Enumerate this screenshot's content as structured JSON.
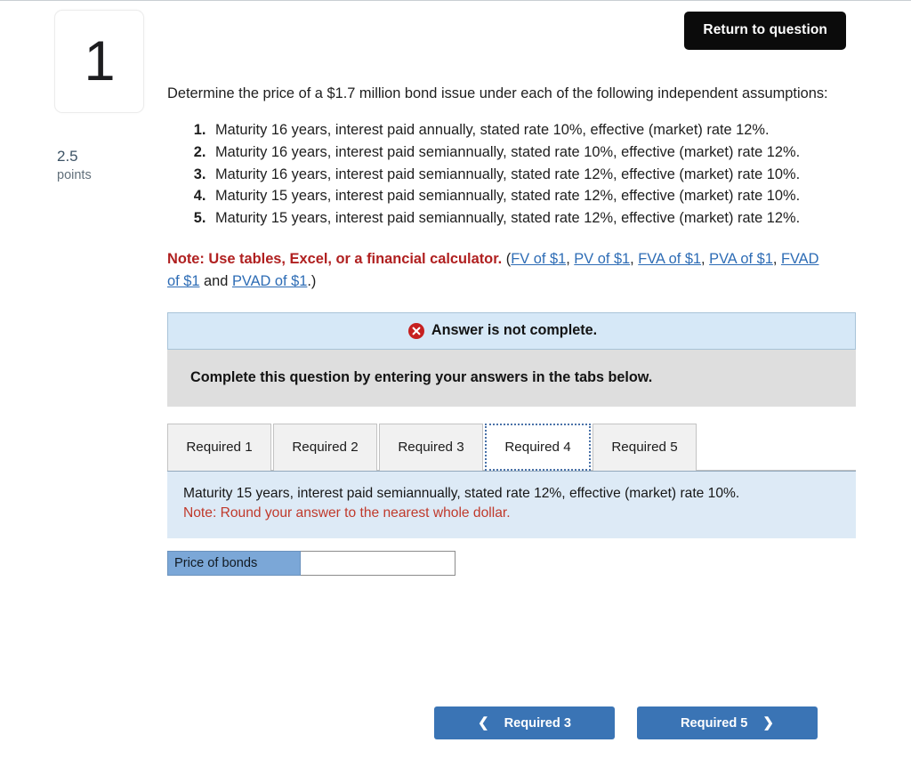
{
  "header": {
    "return_button_label": "Return to question"
  },
  "question_meta": {
    "number": "1",
    "points_value": "2.5",
    "points_label": "points"
  },
  "question": {
    "intro": "Determine the price of a $1.7 million bond issue under each of the following independent assumptions:",
    "assumptions": [
      "Maturity 16 years, interest paid annually, stated rate 10%, effective (market) rate 12%.",
      "Maturity 16 years, interest paid semiannually, stated rate 10%, effective (market) rate 12%.",
      "Maturity 16 years, interest paid semiannually, stated rate 12%, effective (market) rate 10%.",
      "Maturity 15 years, interest paid semiannually, stated rate 12%, effective (market) rate 10%.",
      "Maturity 15 years, interest paid semiannually, stated rate 12%, effective (market) rate 12%."
    ],
    "note_bold": "Note: Use tables, Excel, or a financial calculator.",
    "note_open_paren": " (",
    "note_links": [
      "FV of $1",
      "PV of $1",
      "FVA of $1",
      "PVA of $1",
      "FVAD of $1",
      "PVAD of $1"
    ],
    "note_separator": ", ",
    "note_and": " and ",
    "note_close_paren": ".)"
  },
  "status": {
    "icon": "error-circle-x-icon",
    "text": "Answer is not complete.",
    "instruction": "Complete this question by entering your answers in the tabs below."
  },
  "tabs": {
    "items": [
      {
        "label": "Required 1",
        "active": false
      },
      {
        "label": "Required 2",
        "active": false
      },
      {
        "label": "Required 3",
        "active": false
      },
      {
        "label": "Required 4",
        "active": true
      },
      {
        "label": "Required 5",
        "active": false
      }
    ],
    "active_index": 3
  },
  "panel": {
    "prompt": "Maturity 15 years, interest paid semiannually, stated rate 12%, effective (market) rate 10%.",
    "note": "Note: Round your answer to the nearest whole dollar."
  },
  "answer": {
    "label": "Price of bonds",
    "value": "",
    "placeholder": ""
  },
  "bottom_nav": {
    "prev_label": "Required 3",
    "prev_icon": "chevron-left-icon",
    "next_label": "Required 5",
    "next_icon": "chevron-right-icon"
  },
  "colors": {
    "accent_blue": "#3a74b5",
    "link_blue": "#2d6cb5",
    "note_red": "#b02020",
    "panel_blue": "#ddeaf6",
    "banner_blue": "#d6e8f7",
    "instruct_gray": "#dedede",
    "answer_label_blue": "#7ba7d7",
    "button_black": "#0b0b0b"
  }
}
